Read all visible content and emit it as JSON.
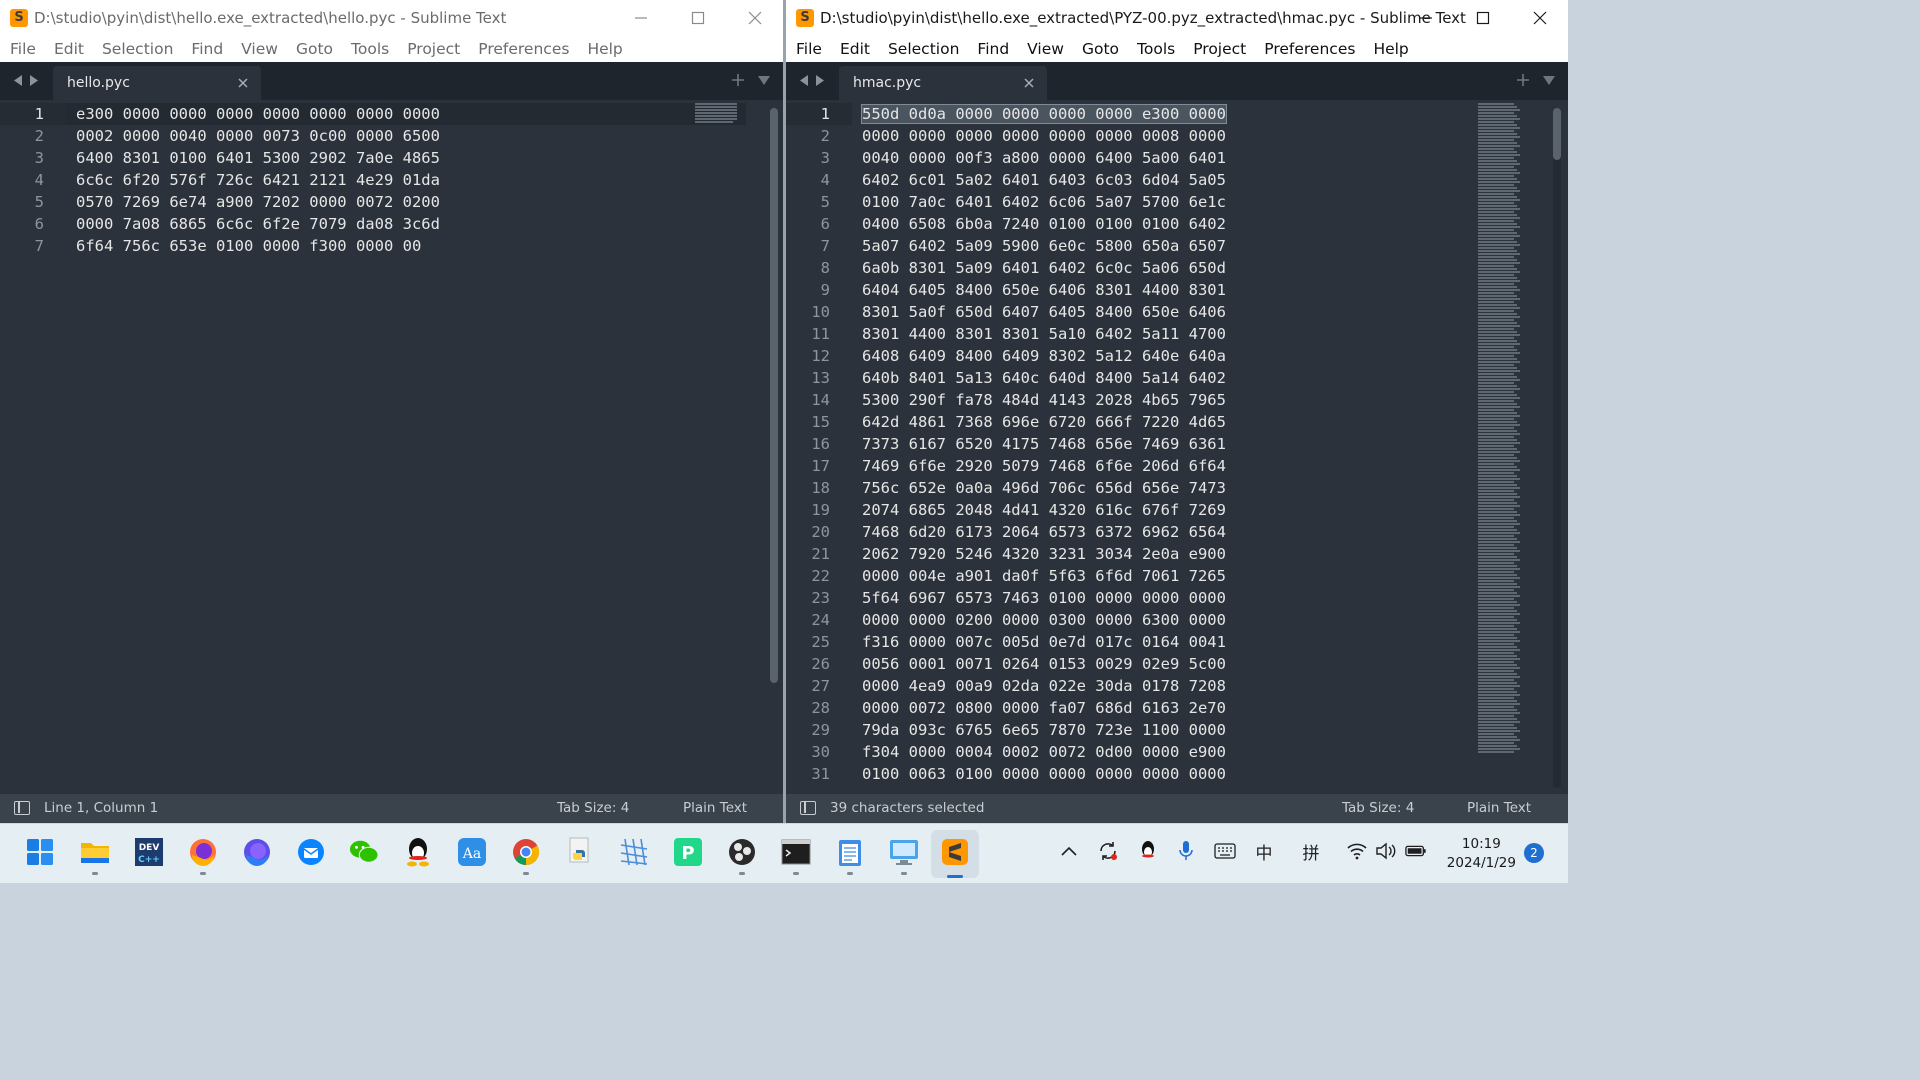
{
  "left_window": {
    "title": "D:\\studio\\pyin\\dist\\hello.exe_extracted\\hello.pyc - Sublime Text",
    "menu": [
      "File",
      "Edit",
      "Selection",
      "Find",
      "View",
      "Goto",
      "Tools",
      "Project",
      "Preferences",
      "Help"
    ],
    "tab": {
      "label": "hello.pyc"
    },
    "lines": [
      "e300 0000 0000 0000 0000 0000 0000 0000",
      "0002 0000 0040 0000 0073 0c00 0000 6500",
      "6400 8301 0100 6401 5300 2902 7a0e 4865",
      "6c6c 6f20 576f 726c 6421 2121 4e29 01da",
      "0570 7269 6e74 a900 7202 0000 0072 0200",
      "0000 7a08 6865 6c6c 6f2e 7079 da08 3c6d",
      "6f64 756c 653e 0100 0000 f300 0000 00"
    ],
    "status": {
      "position": "Line 1, Column 1",
      "tab_size": "Tab Size: 4",
      "syntax": "Plain Text"
    }
  },
  "right_window": {
    "title": "D:\\studio\\pyin\\dist\\hello.exe_extracted\\PYZ-00.pyz_extracted\\hmac.pyc - Sublime Text",
    "menu": [
      "File",
      "Edit",
      "Selection",
      "Find",
      "View",
      "Goto",
      "Tools",
      "Project",
      "Preferences",
      "Help"
    ],
    "tab": {
      "label": "hmac.pyc"
    },
    "lines": [
      "550d 0d0a 0000 0000 0000 0000 e300 0000",
      "0000 0000 0000 0000 0000 0000 0008 0000",
      "0040 0000 00f3 a800 0000 6400 5a00 6401",
      "6402 6c01 5a02 6401 6403 6c03 6d04 5a05",
      "0100 7a0c 6401 6402 6c06 5a07 5700 6e1c",
      "0400 6508 6b0a 7240 0100 0100 0100 6402",
      "5a07 6402 5a09 5900 6e0c 5800 650a 6507",
      "6a0b 8301 5a09 6401 6402 6c0c 5a06 650d",
      "6404 6405 8400 650e 6406 8301 4400 8301",
      "8301 5a0f 650d 6407 6405 8400 650e 6406",
      "8301 4400 8301 8301 5a10 6402 5a11 4700",
      "6408 6409 8400 6409 8302 5a12 640e 640a",
      "640b 8401 5a13 640c 640d 8400 5a14 6402",
      "5300 290f fa78 484d 4143 2028 4b65 7965",
      "642d 4861 7368 696e 6720 666f 7220 4d65",
      "7373 6167 6520 4175 7468 656e 7469 6361",
      "7469 6f6e 2920 5079 7468 6f6e 206d 6f64",
      "756c 652e 0a0a 496d 706c 656d 656e 7473",
      "2074 6865 2048 4d41 4320 616c 676f 7269",
      "7468 6d20 6173 2064 6573 6372 6962 6564",
      "2062 7920 5246 4320 3231 3034 2e0a e900",
      "0000 004e a901 da0f 5f63 6f6d 7061 7265",
      "5f64 6967 6573 7463 0100 0000 0000 0000",
      "0000 0000 0200 0000 0300 0000 6300 0000",
      "f316 0000 007c 005d 0e7d 017c 0164 0041",
      "0056 0001 0071 0264 0153 0029 02e9 5c00",
      "0000 4ea9 00a9 02da 022e 30da 0178 7208",
      "0000 0072 0800 0000 fa07 686d 6163 2e70",
      "79da 093c 6765 6e65 7870 723e 1100 0000",
      "f304 0000 0004 0002 0072 0d00 0000 e900",
      "0100 0063 0100 0000 0000 0000 0000 0000"
    ],
    "status": {
      "selection": "39 characters selected",
      "tab_size": "Tab Size: 4",
      "syntax": "Plain Text"
    }
  },
  "taskbar": {
    "apps": [
      "windows-start",
      "file-explorer",
      "dev-cpp",
      "firefox",
      "firefox-nightly",
      "thunderbird",
      "wechat",
      "qq",
      "dictionary",
      "chrome",
      "python-idle",
      "network-tool",
      "pycharm",
      "obs",
      "terminal",
      "notepad",
      "remote-desktop",
      "sublime-text"
    ],
    "tray": {
      "ime_lang": "中",
      "ime_mode": "拼"
    },
    "clock": {
      "time": "10:19",
      "date": "2024/1/29"
    },
    "notifications": "2"
  },
  "colors": {
    "editor_bg": "#2b323b",
    "tab_bar": "#1f252c",
    "status_bar": "#3a424b",
    "caret": "#ff9c3a",
    "taskbar": "#e4eef3"
  }
}
